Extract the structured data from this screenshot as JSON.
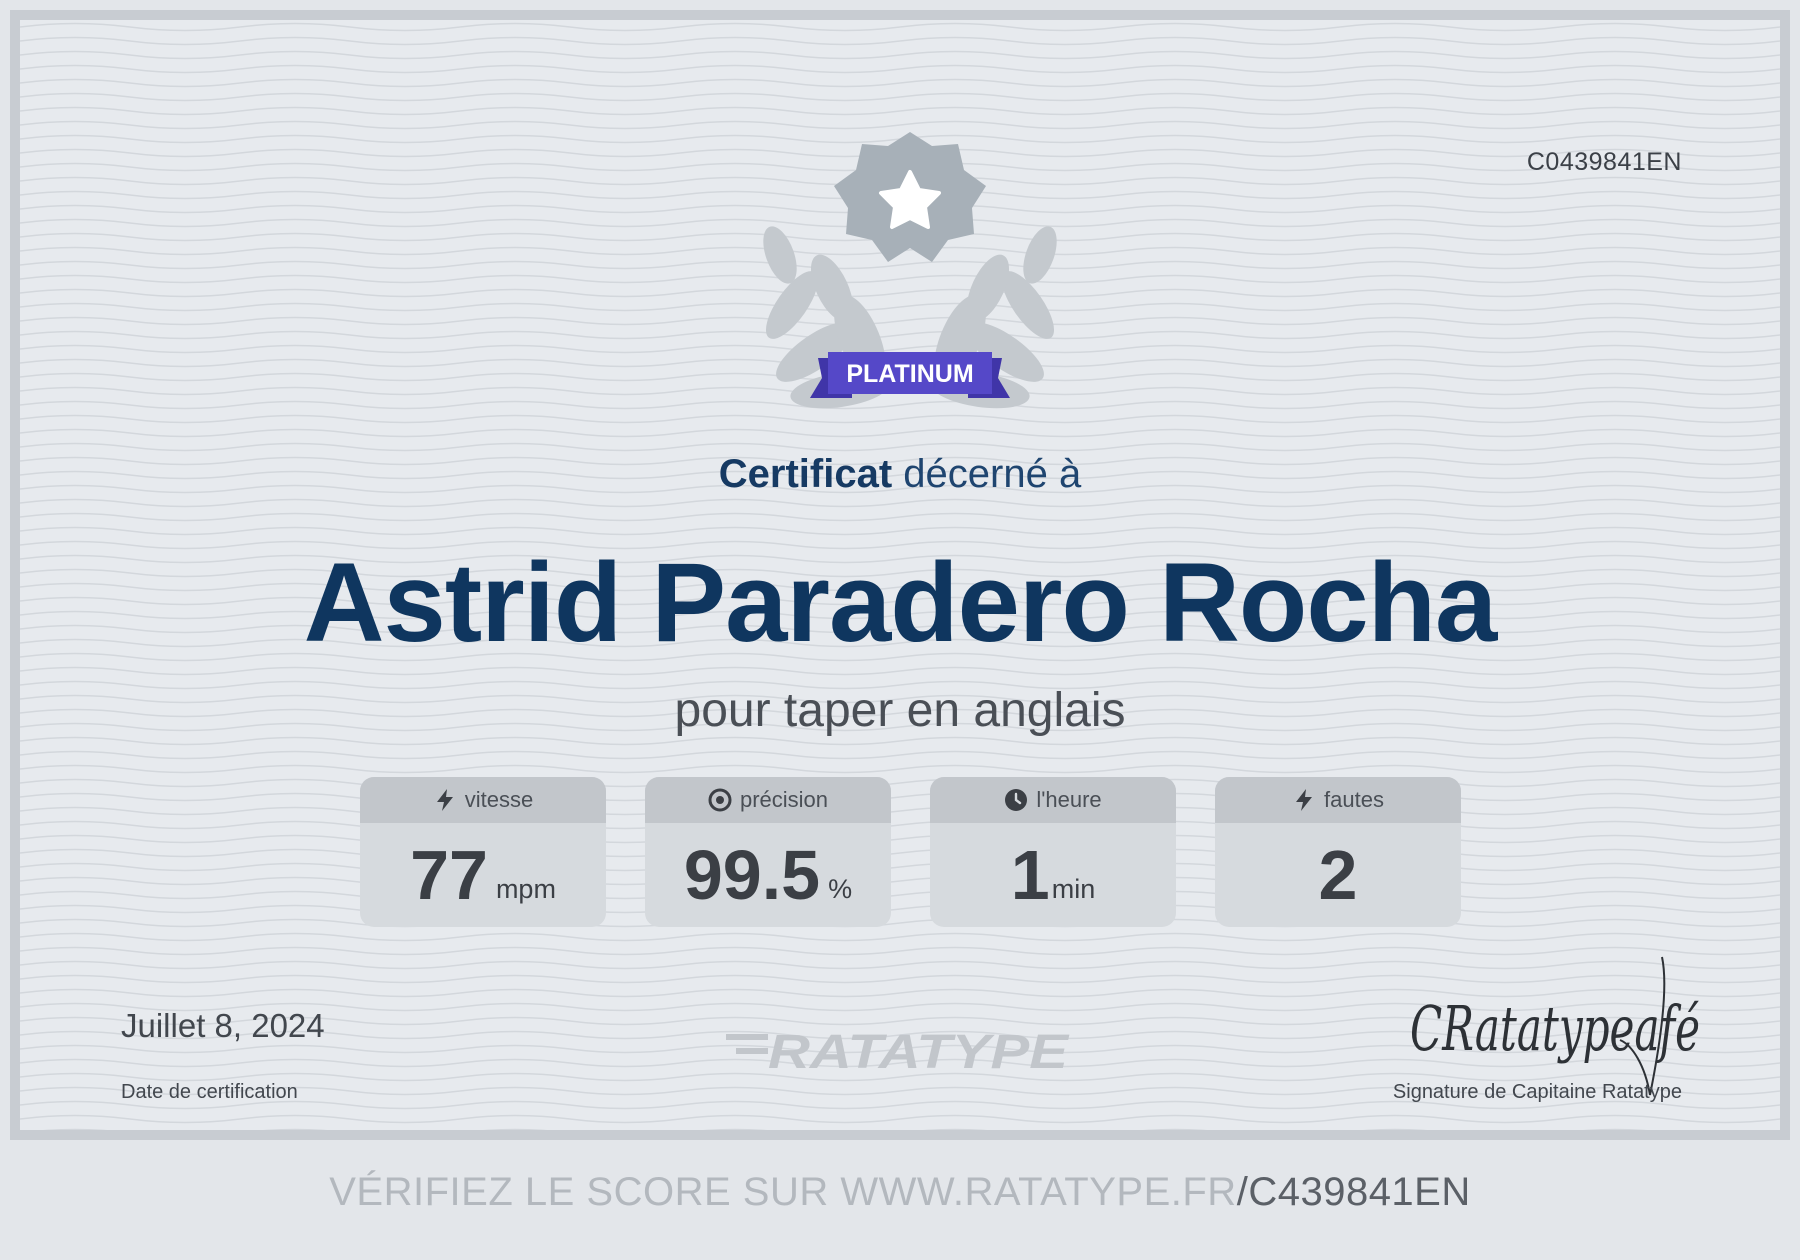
{
  "certificate": {
    "id": "C0439841EN",
    "badge": "PLATINUM",
    "heading_bold": "Certificat",
    "heading_rest": "décerné à",
    "recipient": "Astrid Paradero Rocha",
    "subtitle": "pour taper en anglais",
    "date": "Juillet 8, 2024",
    "date_label": "Date de certification",
    "logo_text": "RATATYPE",
    "signature_label": "Signature de Capitaine Ratatype",
    "signature_script": "CRatatypeafé"
  },
  "stats": [
    {
      "label": "vitesse",
      "value": "77",
      "unit": "mpm",
      "icon": "lightning-icon"
    },
    {
      "label": "précision",
      "value": "99.5",
      "unit": "%",
      "icon": "target-icon"
    },
    {
      "label": "l'heure",
      "value": "1",
      "unit": "min",
      "icon": "clock-icon"
    },
    {
      "label": "fautes",
      "value": "2",
      "unit": "",
      "icon": "lightning-icon"
    }
  ],
  "verify": {
    "prefix": "VÉRIFIEZ LE SCORE SUR WWW.RATATYPE.FR",
    "code": "/C439841EN"
  },
  "colors": {
    "badge": "#5548c8",
    "name": "#0f365f",
    "emblem": "#a7b0b8"
  }
}
